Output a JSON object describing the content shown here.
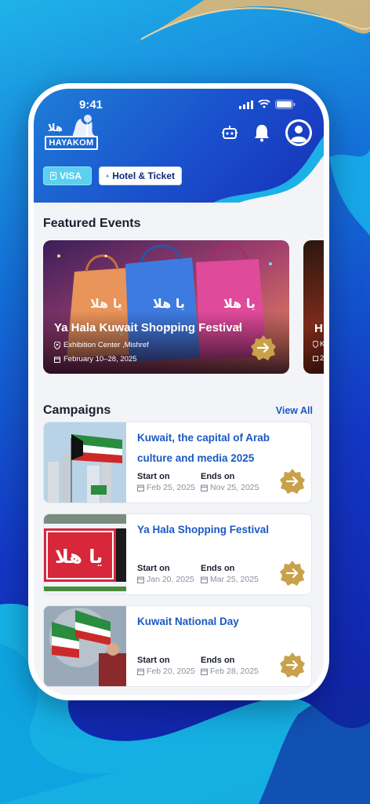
{
  "status": {
    "time": "9:41"
  },
  "app": {
    "logo_text": "HAYAKOM",
    "logo_arabic": "هلا بكم"
  },
  "header_icons": [
    "robot-icon",
    "bell-icon",
    "profile-icon"
  ],
  "pills": {
    "visa": "VISA",
    "hotel": "Hotel & Ticket"
  },
  "featured": {
    "title": "Featured Events",
    "card": {
      "title": "Ya Hala Kuwait Shopping Festival",
      "location": "Exhibition Center ,Mishref",
      "date": "February 10–28, 2025"
    },
    "peek": {
      "title": "H",
      "location": "K",
      "date": "2"
    }
  },
  "campaigns": {
    "title": "Campaigns",
    "view_all": "View All",
    "start_label": "Start on",
    "end_label": "Ends on",
    "items": [
      {
        "title": "Kuwait, the capital of Arab culture and media 2025",
        "start": "Feb 25, 2025",
        "end": "Nov 25, 2025"
      },
      {
        "title": "Ya Hala Shopping Festival",
        "start": "Jan 20, 2025",
        "end": "Mar 25, 2025"
      },
      {
        "title": "Kuwait National Day",
        "start": "Feb 20, 2025",
        "end": "Feb 28, 2025"
      }
    ]
  },
  "colors": {
    "accent": "#1a59c4",
    "gold": "#c9a14a",
    "header": "#1a4fcc",
    "bg": "#1337c4"
  }
}
